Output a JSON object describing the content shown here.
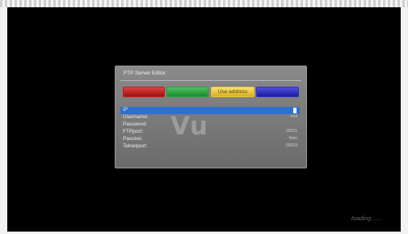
{
  "dialog": {
    "title": "FTP Server Editor",
    "buttons": {
      "red": "",
      "green": "",
      "yellow": "Use address",
      "blue": ""
    },
    "fields": [
      {
        "label": "IP",
        "value": "",
        "selected": true
      },
      {
        "label": "Username:",
        "value": "root"
      },
      {
        "label": "Password:",
        "value": ""
      },
      {
        "label": "FTPport:",
        "value": "00021"
      },
      {
        "label": "Passive:",
        "value": "Nein"
      },
      {
        "label": "Telnetport:",
        "value": "00023"
      }
    ],
    "logo_text": "Vu"
  },
  "status": {
    "loading_text": "loading ......"
  },
  "colors": {
    "highlight": "#2f6fd0",
    "red": "#c02020",
    "green": "#2aa040",
    "yellow": "#e6c33a",
    "blue": "#3434c0"
  }
}
